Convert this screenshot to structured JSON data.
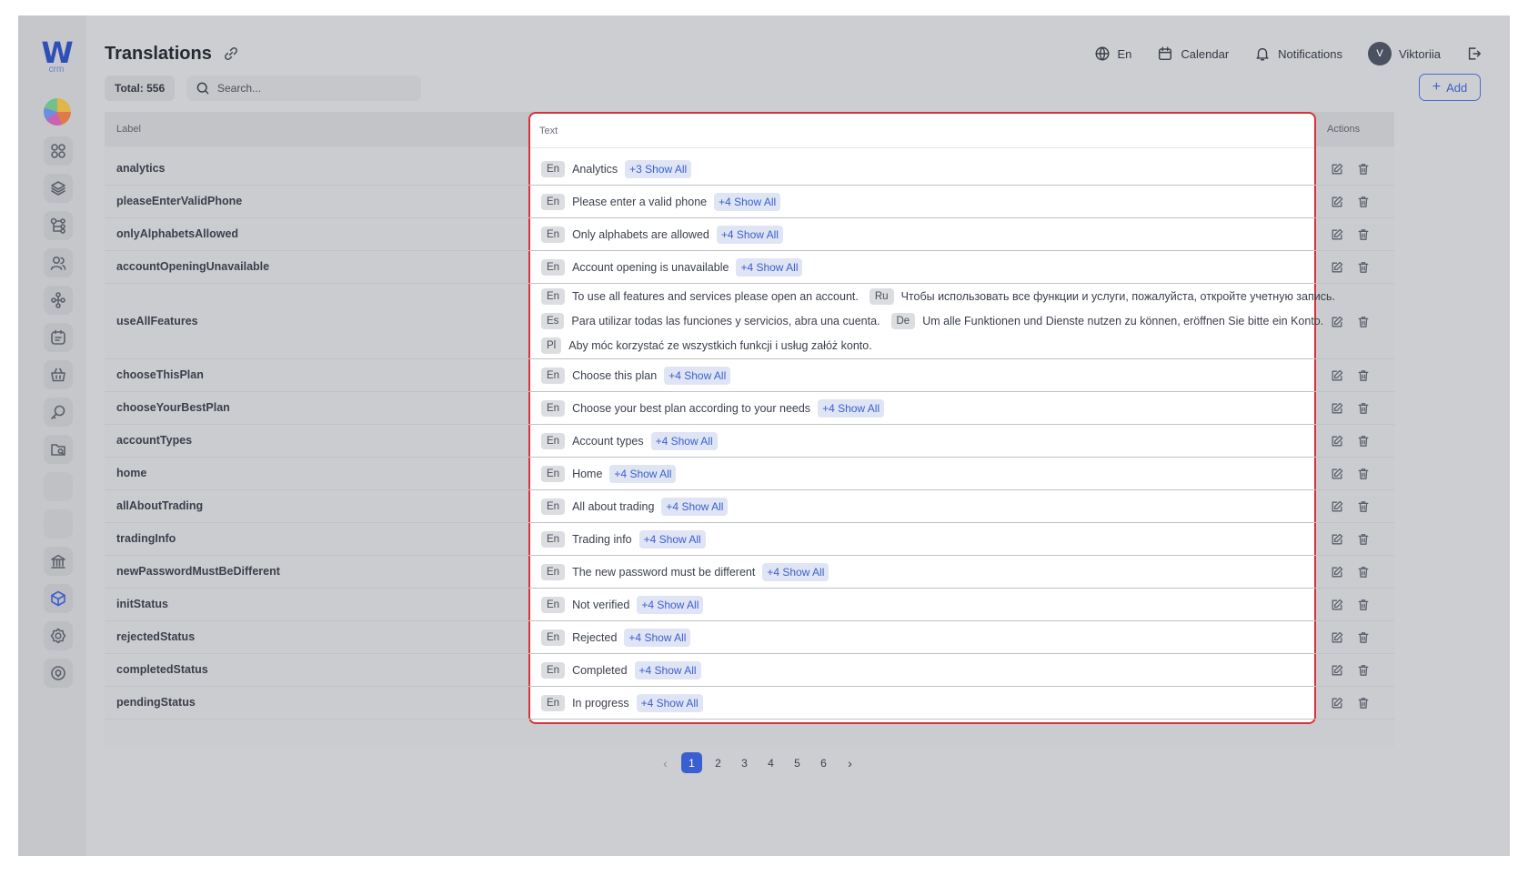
{
  "app": {
    "logo_letter": "W",
    "logo_sub": "crm",
    "title": "Translations"
  },
  "header": {
    "language": "En",
    "calendar": "Calendar",
    "notifications": "Notifications",
    "user_initial": "V",
    "user_name": "Viktoriia"
  },
  "toolbar": {
    "total": "Total: 556",
    "search_placeholder": "Search...",
    "add_label": "Add"
  },
  "columns": {
    "label": "Label",
    "text": "Text",
    "actions": "Actions"
  },
  "rows": [
    {
      "label": "analytics",
      "lines": [
        [
          [
            "En",
            "Analytics"
          ]
        ]
      ],
      "more": "+3 Show All"
    },
    {
      "label": "pleaseEnterValidPhone",
      "lines": [
        [
          [
            "En",
            "Please enter a valid phone"
          ]
        ]
      ],
      "more": "+4 Show All"
    },
    {
      "label": "onlyAlphabetsAllowed",
      "lines": [
        [
          [
            "En",
            "Only alphabets are allowed"
          ]
        ]
      ],
      "more": "+4 Show All"
    },
    {
      "label": "accountOpeningUnavailable",
      "lines": [
        [
          [
            "En",
            "Account opening is unavailable"
          ]
        ]
      ],
      "more": "+4 Show All"
    },
    {
      "label": "useAllFeatures",
      "lines": [
        [
          [
            "En",
            "To use all features and services please open an account."
          ],
          [
            "Ru",
            "Чтобы использовать все функции и услуги, пожалуйста, откройте учетную запись."
          ]
        ],
        [
          [
            "Es",
            "Para utilizar todas las funciones y servicios, abra una cuenta."
          ],
          [
            "De",
            "Um alle Funktionen und Dienste nutzen zu können, eröffnen Sie bitte ein Konto."
          ]
        ],
        [
          [
            "Pl",
            "Aby móc korzystać ze wszystkich funkcji i usług załóż konto."
          ]
        ]
      ],
      "more": ""
    },
    {
      "label": "chooseThisPlan",
      "lines": [
        [
          [
            "En",
            "Choose this plan"
          ]
        ]
      ],
      "more": "+4 Show All"
    },
    {
      "label": "chooseYourBestPlan",
      "lines": [
        [
          [
            "En",
            "Choose your best plan according to your needs"
          ]
        ]
      ],
      "more": "+4 Show All"
    },
    {
      "label": "accountTypes",
      "lines": [
        [
          [
            "En",
            "Account types"
          ]
        ]
      ],
      "more": "+4 Show All"
    },
    {
      "label": "home",
      "lines": [
        [
          [
            "En",
            "Home"
          ]
        ]
      ],
      "more": "+4 Show All"
    },
    {
      "label": "allAboutTrading",
      "lines": [
        [
          [
            "En",
            "All about trading"
          ]
        ]
      ],
      "more": "+4 Show All"
    },
    {
      "label": "tradingInfo",
      "lines": [
        [
          [
            "En",
            "Trading info"
          ]
        ]
      ],
      "more": "+4 Show All"
    },
    {
      "label": "newPasswordMustBeDifferent",
      "lines": [
        [
          [
            "En",
            "The new password must be different"
          ]
        ]
      ],
      "more": "+4 Show All"
    },
    {
      "label": "initStatus",
      "lines": [
        [
          [
            "En",
            "Not verified"
          ]
        ]
      ],
      "more": "+4 Show All"
    },
    {
      "label": "rejectedStatus",
      "lines": [
        [
          [
            "En",
            "Rejected"
          ]
        ]
      ],
      "more": "+4 Show All"
    },
    {
      "label": "completedStatus",
      "lines": [
        [
          [
            "En",
            "Completed"
          ]
        ]
      ],
      "more": "+4 Show All"
    },
    {
      "label": "pendingStatus",
      "lines": [
        [
          [
            "En",
            "In progress"
          ]
        ]
      ],
      "more": "+4 Show All"
    }
  ],
  "pagination": {
    "pages": [
      "1",
      "2",
      "3",
      "4",
      "5",
      "6"
    ],
    "current": "1",
    "prev": "‹",
    "next": "›"
  },
  "colors": {
    "accent": "#3b5fd0",
    "highlight_border": "#d9313a"
  },
  "sidebar_icons": [
    "dashboard-icon",
    "layers-icon",
    "hierarchy-icon",
    "users-icon",
    "network-icon",
    "tasks-icon",
    "basket-icon",
    "key-search-icon",
    "folder-icon",
    "blank",
    "blank",
    "bank-icon",
    "cube-icon",
    "settings-icon",
    "shield-icon"
  ]
}
